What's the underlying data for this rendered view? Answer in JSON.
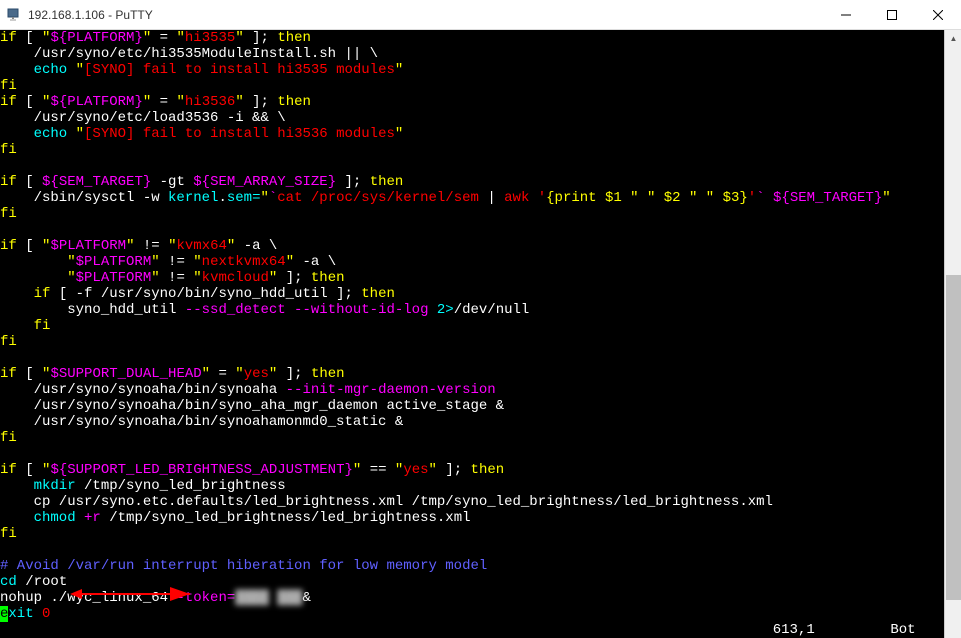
{
  "window": {
    "title": "192.168.1.106 - PuTTY"
  },
  "terminal": {
    "lines": [
      [
        {
          "c": "yellow",
          "t": "if"
        },
        {
          "c": "white",
          "t": " [ "
        },
        {
          "c": "yellow",
          "t": "\""
        },
        {
          "c": "magenta",
          "t": "${PLATFORM}"
        },
        {
          "c": "yellow",
          "t": "\""
        },
        {
          "c": "white",
          "t": " = "
        },
        {
          "c": "yellow",
          "t": "\""
        },
        {
          "c": "red",
          "t": "hi3535"
        },
        {
          "c": "yellow",
          "t": "\""
        },
        {
          "c": "white",
          "t": " ]; "
        },
        {
          "c": "yellow",
          "t": "then"
        }
      ],
      [
        {
          "c": "white",
          "t": "    /usr/syno/etc/hi3535ModuleInstall.sh || \\"
        }
      ],
      [
        {
          "c": "cyan",
          "t": "    echo"
        },
        {
          "c": "white",
          "t": " "
        },
        {
          "c": "yellow",
          "t": "\""
        },
        {
          "c": "red",
          "t": "[SYNO] fail to install hi3535 modules"
        },
        {
          "c": "yellow",
          "t": "\""
        }
      ],
      [
        {
          "c": "yellow",
          "t": "fi"
        }
      ],
      [
        {
          "c": "yellow",
          "t": "if"
        },
        {
          "c": "white",
          "t": " [ "
        },
        {
          "c": "yellow",
          "t": "\""
        },
        {
          "c": "magenta",
          "t": "${PLATFORM}"
        },
        {
          "c": "yellow",
          "t": "\""
        },
        {
          "c": "white",
          "t": " = "
        },
        {
          "c": "yellow",
          "t": "\""
        },
        {
          "c": "red",
          "t": "hi3536"
        },
        {
          "c": "yellow",
          "t": "\""
        },
        {
          "c": "white",
          "t": " ]; "
        },
        {
          "c": "yellow",
          "t": "then"
        }
      ],
      [
        {
          "c": "white",
          "t": "    /usr/syno/etc/load3536 -i && \\"
        }
      ],
      [
        {
          "c": "cyan",
          "t": "    echo"
        },
        {
          "c": "white",
          "t": " "
        },
        {
          "c": "yellow",
          "t": "\""
        },
        {
          "c": "red",
          "t": "[SYNO] fail to install hi3536 modules"
        },
        {
          "c": "yellow",
          "t": "\""
        }
      ],
      [
        {
          "c": "yellow",
          "t": "fi"
        }
      ],
      [
        {
          "c": "white",
          "t": ""
        }
      ],
      [
        {
          "c": "yellow",
          "t": "if"
        },
        {
          "c": "white",
          "t": " [ "
        },
        {
          "c": "magenta",
          "t": "${SEM_TARGET}"
        },
        {
          "c": "white",
          "t": " -gt "
        },
        {
          "c": "magenta",
          "t": "${SEM_ARRAY_SIZE}"
        },
        {
          "c": "white",
          "t": " ]; "
        },
        {
          "c": "yellow",
          "t": "then"
        }
      ],
      [
        {
          "c": "white",
          "t": "    /sbin/sysctl -w "
        },
        {
          "c": "cyan",
          "t": "kernel"
        },
        {
          "c": "white",
          "t": "."
        },
        {
          "c": "cyan",
          "t": "sem="
        },
        {
          "c": "yellow",
          "t": "\""
        },
        {
          "c": "magenta",
          "t": "`"
        },
        {
          "c": "red",
          "t": "cat /proc/sys/kernel/sem "
        },
        {
          "c": "white",
          "t": "|"
        },
        {
          "c": "red",
          "t": " awk '"
        },
        {
          "c": "yellow",
          "t": "{print $1 \" \" $2 \" \" $3}"
        },
        {
          "c": "red",
          "t": "'"
        },
        {
          "c": "magenta",
          "t": "`"
        },
        {
          "c": "red",
          "t": " "
        },
        {
          "c": "magenta",
          "t": "${SEM_TARGET}"
        },
        {
          "c": "yellow",
          "t": "\""
        }
      ],
      [
        {
          "c": "yellow",
          "t": "fi"
        }
      ],
      [
        {
          "c": "white",
          "t": ""
        }
      ],
      [
        {
          "c": "yellow",
          "t": "if"
        },
        {
          "c": "white",
          "t": " [ "
        },
        {
          "c": "yellow",
          "t": "\""
        },
        {
          "c": "magenta",
          "t": "$PLATFORM"
        },
        {
          "c": "yellow",
          "t": "\""
        },
        {
          "c": "white",
          "t": " != "
        },
        {
          "c": "yellow",
          "t": "\""
        },
        {
          "c": "red",
          "t": "kvmx64"
        },
        {
          "c": "yellow",
          "t": "\""
        },
        {
          "c": "white",
          "t": " -a \\"
        }
      ],
      [
        {
          "c": "white",
          "t": "        "
        },
        {
          "c": "yellow",
          "t": "\""
        },
        {
          "c": "magenta",
          "t": "$PLATFORM"
        },
        {
          "c": "yellow",
          "t": "\""
        },
        {
          "c": "white",
          "t": " != "
        },
        {
          "c": "yellow",
          "t": "\""
        },
        {
          "c": "red",
          "t": "nextkvmx64"
        },
        {
          "c": "yellow",
          "t": "\""
        },
        {
          "c": "white",
          "t": " -a \\"
        }
      ],
      [
        {
          "c": "white",
          "t": "        "
        },
        {
          "c": "yellow",
          "t": "\""
        },
        {
          "c": "magenta",
          "t": "$PLATFORM"
        },
        {
          "c": "yellow",
          "t": "\""
        },
        {
          "c": "white",
          "t": " != "
        },
        {
          "c": "yellow",
          "t": "\""
        },
        {
          "c": "red",
          "t": "kvmcloud"
        },
        {
          "c": "yellow",
          "t": "\""
        },
        {
          "c": "white",
          "t": " ]; "
        },
        {
          "c": "yellow",
          "t": "then"
        }
      ],
      [
        {
          "c": "yellow",
          "t": "    if"
        },
        {
          "c": "white",
          "t": " [ -f /usr/syno/bin/syno_hdd_util ]; "
        },
        {
          "c": "yellow",
          "t": "then"
        }
      ],
      [
        {
          "c": "white",
          "t": "        syno_hdd_util "
        },
        {
          "c": "magenta",
          "t": "--ssd_detect --without-id-log"
        },
        {
          "c": "white",
          "t": " "
        },
        {
          "c": "cyan",
          "t": "2>"
        },
        {
          "c": "white",
          "t": "/dev/null"
        }
      ],
      [
        {
          "c": "yellow",
          "t": "    fi"
        }
      ],
      [
        {
          "c": "yellow",
          "t": "fi"
        }
      ],
      [
        {
          "c": "white",
          "t": ""
        }
      ],
      [
        {
          "c": "yellow",
          "t": "if"
        },
        {
          "c": "white",
          "t": " [ "
        },
        {
          "c": "yellow",
          "t": "\""
        },
        {
          "c": "magenta",
          "t": "$SUPPORT_DUAL_HEAD"
        },
        {
          "c": "yellow",
          "t": "\""
        },
        {
          "c": "white",
          "t": " = "
        },
        {
          "c": "yellow",
          "t": "\""
        },
        {
          "c": "red",
          "t": "yes"
        },
        {
          "c": "yellow",
          "t": "\""
        },
        {
          "c": "white",
          "t": " ]; "
        },
        {
          "c": "yellow",
          "t": "then"
        }
      ],
      [
        {
          "c": "white",
          "t": "    /usr/syno/synoaha/bin/synoaha "
        },
        {
          "c": "magenta",
          "t": "--init-mgr-daemon-version"
        }
      ],
      [
        {
          "c": "white",
          "t": "    /usr/syno/synoaha/bin/syno_aha_mgr_daemon active_stage &"
        }
      ],
      [
        {
          "c": "white",
          "t": "    /usr/syno/synoaha/bin/synoahamonmd0_static &"
        }
      ],
      [
        {
          "c": "yellow",
          "t": "fi"
        }
      ],
      [
        {
          "c": "white",
          "t": ""
        }
      ],
      [
        {
          "c": "yellow",
          "t": "if"
        },
        {
          "c": "white",
          "t": " [ "
        },
        {
          "c": "yellow",
          "t": "\""
        },
        {
          "c": "magenta",
          "t": "${SUPPORT_LED_BRIGHTNESS_ADJUSTMENT}"
        },
        {
          "c": "yellow",
          "t": "\""
        },
        {
          "c": "white",
          "t": " == "
        },
        {
          "c": "yellow",
          "t": "\""
        },
        {
          "c": "red",
          "t": "yes"
        },
        {
          "c": "yellow",
          "t": "\""
        },
        {
          "c": "white",
          "t": " ]; "
        },
        {
          "c": "yellow",
          "t": "then"
        }
      ],
      [
        {
          "c": "cyan",
          "t": "    mkdir"
        },
        {
          "c": "white",
          "t": " /tmp/syno_led_brightness"
        }
      ],
      [
        {
          "c": "white",
          "t": "    cp /usr/syno.etc.defaults/led_brightness.xml /tmp/syno_led_brightness/led_brightness.xml"
        }
      ],
      [
        {
          "c": "cyan",
          "t": "    chmod"
        },
        {
          "c": "white",
          "t": " "
        },
        {
          "c": "magenta",
          "t": "+r"
        },
        {
          "c": "white",
          "t": " /tmp/syno_led_brightness/led_brightness.xml"
        }
      ],
      [
        {
          "c": "yellow",
          "t": "fi"
        }
      ],
      [
        {
          "c": "white",
          "t": ""
        }
      ],
      [
        {
          "c": "blue",
          "t": "# Avoid /var/run interrupt hiberation for low memory model"
        }
      ],
      [
        {
          "c": "cyan",
          "t": "cd"
        },
        {
          "c": "white",
          "t": " /root"
        }
      ],
      [
        {
          "c": "white",
          "t": "nohup ./wyc_linux_64 "
        },
        {
          "c": "magenta",
          "t": "-token="
        },
        {
          "c": "pixelated",
          "t": "████ ███"
        },
        {
          "c": "white",
          "t": "&"
        }
      ],
      [
        {
          "c": "cursor",
          "t": "e"
        },
        {
          "c": "cyan",
          "t": "xit"
        },
        {
          "c": "white",
          "t": " "
        },
        {
          "c": "red",
          "t": "0"
        }
      ]
    ],
    "status": {
      "position": "613,1",
      "indicator": "Bot"
    }
  }
}
